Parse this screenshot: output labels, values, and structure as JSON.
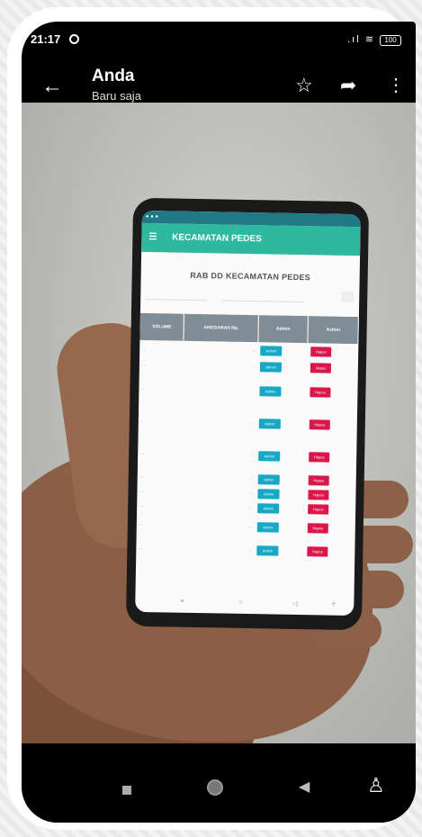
{
  "status": {
    "time": "21:17",
    "battery": "100"
  },
  "header": {
    "title": "Anda",
    "subtitle": "Baru saja"
  },
  "inner_app": {
    "toolbar_title": "KECAMATAN PEDES",
    "heading": "RAB DD KECAMATAN PEDES",
    "columns": [
      "VOLUME",
      "ANGGARAN Rp.",
      "Admin",
      "Action"
    ],
    "edit_label": "Admin",
    "delete_label": "Hapus",
    "rows": [
      {
        "volume": "...",
        "amount": "..."
      },
      {
        "volume": "...",
        "amount": "..."
      },
      {
        "volume": "...",
        "amount": "..."
      },
      {
        "volume": "...",
        "amount": "..."
      },
      {
        "volume": "...",
        "amount": "..."
      },
      {
        "volume": "...",
        "amount": "..."
      },
      {
        "volume": "...",
        "amount": "..."
      },
      {
        "volume": "...",
        "amount": "..."
      },
      {
        "volume": "...",
        "amount": "..."
      },
      {
        "volume": "...",
        "amount": "..."
      }
    ]
  },
  "icons": {
    "back": "arrow-left-icon",
    "star": "star-icon",
    "share": "share-icon",
    "more": "more-vert-icon"
  }
}
